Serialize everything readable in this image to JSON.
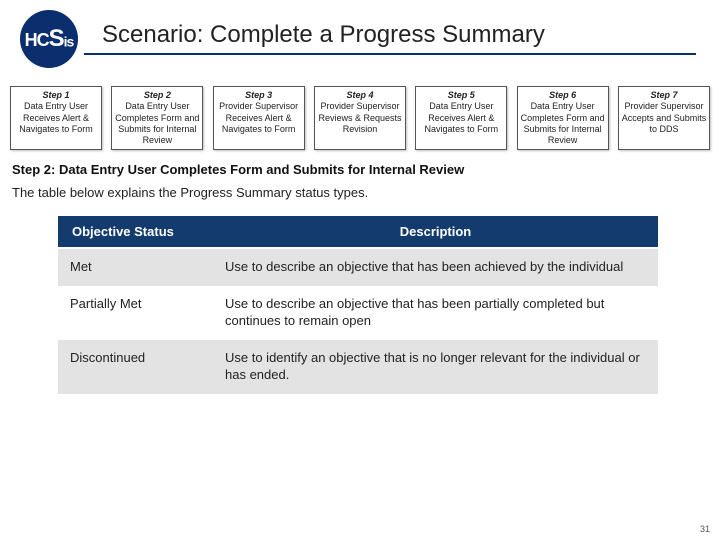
{
  "header": {
    "logo_text_h": "H",
    "logo_text_c": "C",
    "logo_text_s": "S",
    "logo_text_is": "is",
    "title": "Scenario: Complete a Progress Summary"
  },
  "steps": [
    {
      "label": "Step 1",
      "text": "Data Entry User Receives Alert & Navigates to Form"
    },
    {
      "label": "Step 2",
      "text": "Data Entry User Completes Form and Submits for Internal Review"
    },
    {
      "label": "Step 3",
      "text": "Provider Supervisor Receives Alert & Navigates to Form"
    },
    {
      "label": "Step 4",
      "text": "Provider Supervisor Reviews & Requests Revision"
    },
    {
      "label": "Step 5",
      "text": "Data Entry User Receives Alert & Navigates to Form"
    },
    {
      "label": "Step 6",
      "text": "Data Entry User Completes Form and Submits for Internal Review"
    },
    {
      "label": "Step 7",
      "text": "Provider Supervisor Accepts and Submits to DDS"
    }
  ],
  "section_heading": "Step 2: Data Entry User Completes Form and Submits for Internal Review",
  "intro_text": "The table below explains the Progress Summary status types.",
  "table": {
    "headers": [
      "Objective Status",
      "Description"
    ],
    "rows": [
      {
        "status": "Met",
        "desc": "Use to describe an objective that has been achieved by the individual"
      },
      {
        "status": "Partially Met",
        "desc": "Use to describe an objective that has been partially completed but continues to remain open"
      },
      {
        "status": "Discontinued",
        "desc": "Use to identify an objective that is no longer relevant for the individual or has ended."
      }
    ]
  },
  "page_number": "31"
}
